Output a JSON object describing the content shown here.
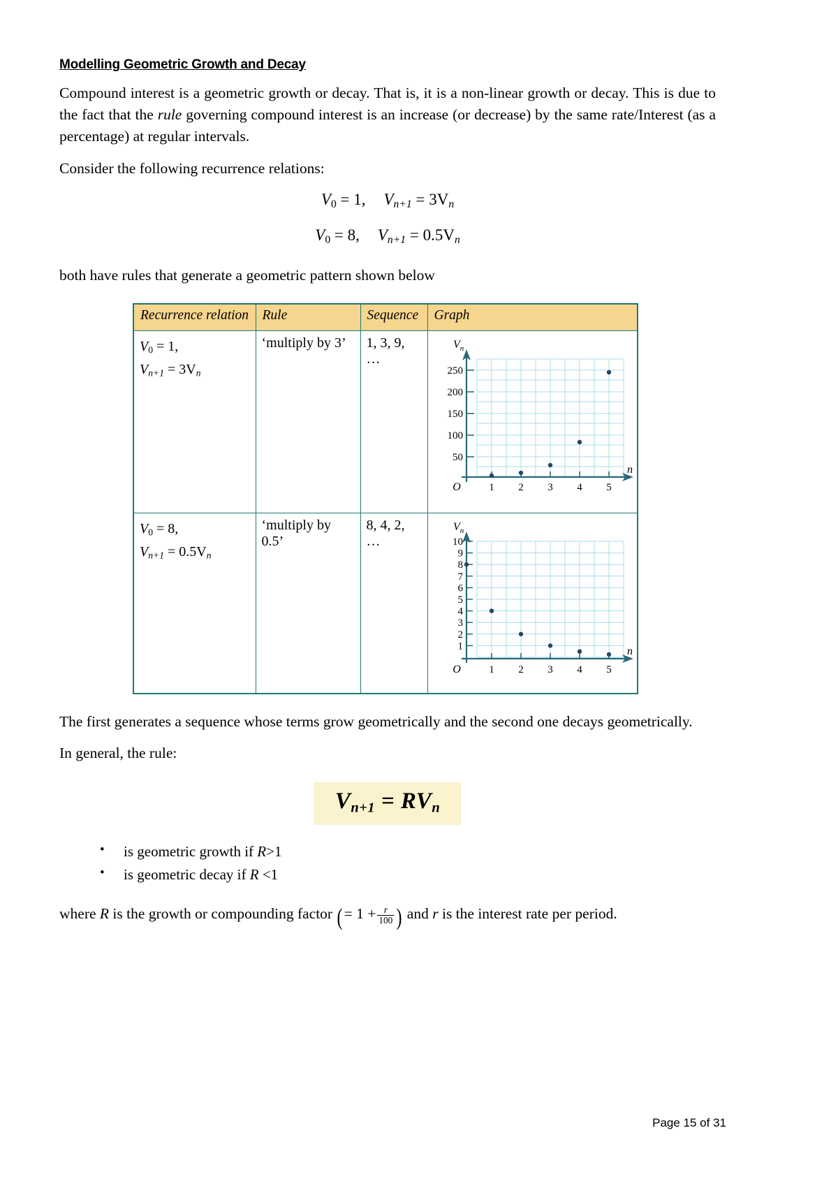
{
  "document": {
    "title": "Modelling Geometric Growth and Decay",
    "paragraphs": {
      "intro_part1": "Compound interest is a geometric growth or decay. That is, it is a non-linear growth or decay. This is due to the fact that the ",
      "intro_italic": "rule",
      "intro_part2": " governing compound interest is an increase (or decrease) by the same rate/Interest (as a percentage) at regular intervals.",
      "consider": "Consider the following recurrence relations:",
      "both_have": "both have rules that generate a geometric pattern shown below",
      "first_generates": "The first generates a sequence whose terms grow geometrically and the second one decays geometrically.",
      "in_general": "In general, the rule:",
      "where_r_part1": "where ",
      "where_r_var": "R",
      "where_r_part2": " is the growth or compounding factor ",
      "where_r_paren_open": "(",
      "where_r_equals": "= 1 +",
      "where_r_frac_num": "r",
      "where_r_frac_den": "100",
      "where_r_paren_close": ")",
      "where_r_part3": " and ",
      "where_r_var2": "r",
      "where_r_part4": " is the interest rate per period."
    },
    "equations": {
      "eq1_lhs_var": "V",
      "eq1_lhs_sub": "0",
      "eq1_lhs_rest": " = 1,",
      "eq1_rhs_var": "V",
      "eq1_rhs_sub": "n+1",
      "eq1_rhs_rest": " = 3V",
      "eq1_rhs_sub2": "n",
      "eq2_lhs_var": "V",
      "eq2_lhs_sub": "0",
      "eq2_lhs_rest": " = 8,",
      "eq2_rhs_var": "V",
      "eq2_rhs_sub": "n+1",
      "eq2_rhs_rest": " = 0.5V",
      "eq2_rhs_sub2": "n"
    },
    "highlight_formula": {
      "lhs_var": "V",
      "lhs_sub": "n+1",
      "operator": " = ",
      "rhs": "RV",
      "rhs_sub": "n"
    },
    "bullets": [
      {
        "text_part1": "is geometric growth if ",
        "var": "R",
        "text_part2": ">1"
      },
      {
        "text_part1": "is geometric decay if ",
        "var": "R",
        "text_part2": " <1"
      }
    ]
  },
  "table": {
    "headers": [
      "Recurrence relation",
      "Rule",
      "Sequence",
      "Graph"
    ],
    "rows": [
      {
        "recurrence_line1_var": "V",
        "recurrence_line1_sub": "0",
        "recurrence_line1_rest": " = 1,",
        "recurrence_line2_var": "V",
        "recurrence_line2_sub": "n+1",
        "recurrence_line2_rest": " = 3V",
        "recurrence_line2_sub2": "n",
        "rule": "‘multiply by 3’",
        "sequence": "1, 3, 9, …"
      },
      {
        "recurrence_line1_var": "V",
        "recurrence_line1_sub": "0",
        "recurrence_line1_rest": " = 8,",
        "recurrence_line2_var": "V",
        "recurrence_line2_sub": "n+1",
        "recurrence_line2_rest": " = 0.5V",
        "recurrence_line2_sub2": "n",
        "rule": "‘multiply by 0.5’",
        "sequence": "8, 4, 2, …"
      }
    ]
  },
  "chart_data": [
    {
      "type": "scatter",
      "title": "",
      "xlabel": "n",
      "ylabel": "Vn",
      "origin_label": "O",
      "x": [
        1,
        2,
        3,
        4,
        5
      ],
      "values": [
        3,
        9,
        27,
        81,
        243
      ],
      "xticks": [
        "1",
        "2",
        "3",
        "4",
        "5"
      ],
      "yticks": [
        "50",
        "100",
        "150",
        "200",
        "250"
      ],
      "ytick_values": [
        50,
        100,
        150,
        200,
        250
      ],
      "xlim": [
        0,
        6
      ],
      "ylim": [
        0,
        275
      ],
      "grid": true,
      "grid_color": "#a8dcec",
      "point_color": "#24485f",
      "axis_color": "#2a6a78"
    },
    {
      "type": "scatter",
      "title": "",
      "xlabel": "n",
      "ylabel": "Vn",
      "origin_label": "O",
      "x": [
        0,
        1,
        2,
        3,
        4,
        5
      ],
      "values": [
        8,
        4,
        2,
        1,
        0.5,
        0.25
      ],
      "xticks": [
        "1",
        "2",
        "3",
        "4",
        "5"
      ],
      "yticks": [
        "1",
        "2",
        "3",
        "4",
        "5",
        "6",
        "7",
        "8",
        "9",
        "10"
      ],
      "ytick_values": [
        1,
        2,
        3,
        4,
        5,
        6,
        7,
        8,
        9,
        10
      ],
      "xlim": [
        0,
        6
      ],
      "ylim": [
        0,
        10.5
      ],
      "grid": true,
      "grid_color": "#a8dcec",
      "point_color": "#24485f",
      "axis_color": "#2a6a78"
    }
  ],
  "footer": {
    "page_label": "Page 15 of 31"
  },
  "colors": {
    "table_header_bg": "#f6d58e",
    "table_border": "#1f7a6e",
    "formula_highlight_bg": "#faf3cd",
    "grid": "#a8dcec",
    "axis": "#2a6a78",
    "point": "#24485f"
  }
}
